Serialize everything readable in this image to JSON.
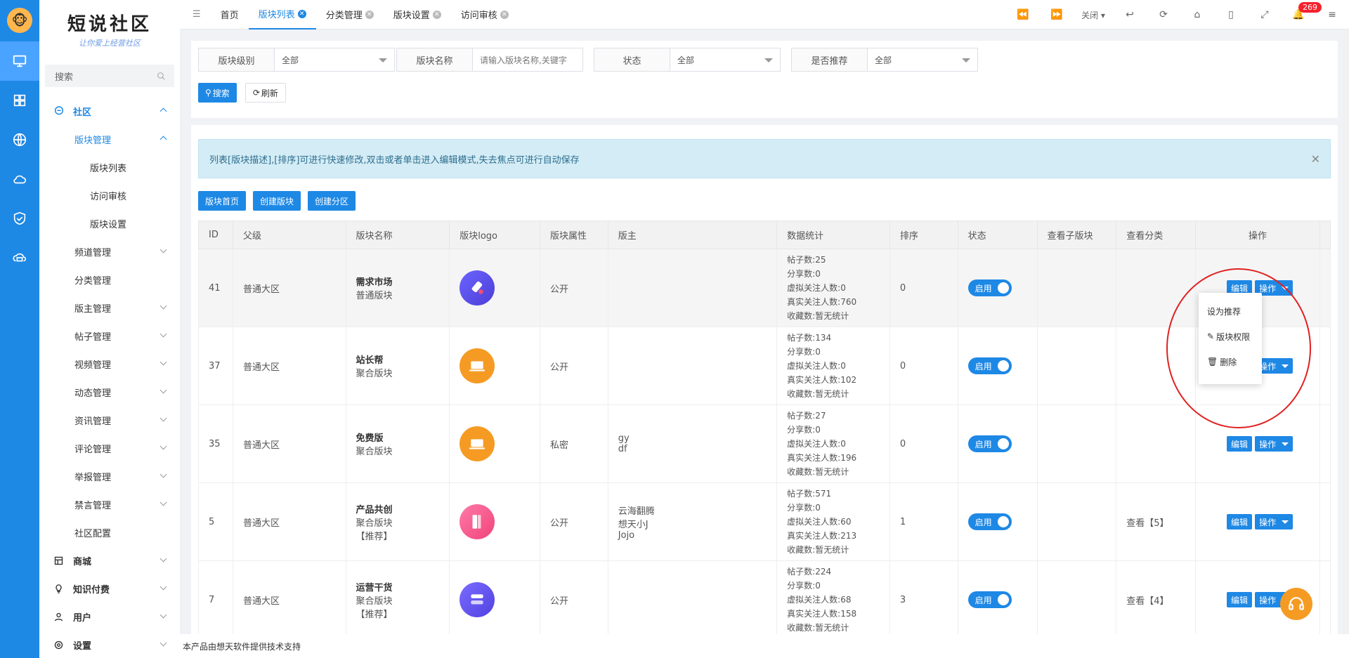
{
  "brand": {
    "title": "短说社区",
    "subtitle": "让你爱上经营社区"
  },
  "sidebar": {
    "search_placeholder": "搜索",
    "items": [
      {
        "label": "社区"
      },
      {
        "label": "版块管理"
      },
      {
        "label": "版块列表"
      },
      {
        "label": "访问审核"
      },
      {
        "label": "版块设置"
      },
      {
        "label": "频道管理"
      },
      {
        "label": "分类管理"
      },
      {
        "label": "版主管理"
      },
      {
        "label": "帖子管理"
      },
      {
        "label": "视频管理"
      },
      {
        "label": "动态管理"
      },
      {
        "label": "资讯管理"
      },
      {
        "label": "评论管理"
      },
      {
        "label": "举报管理"
      },
      {
        "label": "禁言管理"
      },
      {
        "label": "社区配置"
      },
      {
        "label": "商城"
      },
      {
        "label": "知识付费"
      },
      {
        "label": "用户"
      },
      {
        "label": "设置"
      }
    ]
  },
  "tabs": [
    {
      "label": "首页"
    },
    {
      "label": "版块列表"
    },
    {
      "label": "分类管理"
    },
    {
      "label": "版块设置"
    },
    {
      "label": "访问审核"
    }
  ],
  "toolbar": {
    "close_label": "关闭",
    "notify_count": "269"
  },
  "filters": {
    "level": {
      "label": "版块级别",
      "value": "全部"
    },
    "name": {
      "label": "版块名称",
      "placeholder": "请输入版块名称,关键字"
    },
    "status": {
      "label": "状态",
      "value": "全部"
    },
    "recommend": {
      "label": "是否推荐",
      "value": "全部"
    },
    "search_btn": "搜索",
    "refresh_btn": "刷新"
  },
  "alert": "列表[版块描述],[排序]可进行快速修改,双击或者单击进入编辑模式,失去焦点可进行自动保存",
  "actions": {
    "home": "版块首页",
    "create": "创建版块",
    "create_zone": "创建分区"
  },
  "table": {
    "headers": [
      "ID",
      "父级",
      "版块名称",
      "版块logo",
      "版块属性",
      "版主",
      "数据统计",
      "排序",
      "状态",
      "查看子版块",
      "查看分类",
      "操作"
    ],
    "rows": [
      {
        "id": "41",
        "parent": "普通大区",
        "name": "需求市场",
        "type": "普通版块",
        "tag": "",
        "attr": "公开",
        "mods": [
          "",
          "",
          ""
        ],
        "stats": [
          "帖子数:25",
          "分享数:0",
          "虚拟关注人数:0",
          "真实关注人数:760",
          "收藏数:暂无统计"
        ],
        "sort": "0",
        "status": "启用",
        "cat": ""
      },
      {
        "id": "37",
        "parent": "普通大区",
        "name": "站长帮",
        "type": "聚合版块",
        "tag": "",
        "attr": "公开",
        "mods": [
          "",
          "",
          ""
        ],
        "stats": [
          "帖子数:134",
          "分享数:0",
          "虚拟关注人数:0",
          "真实关注人数:102",
          "收藏数:暂无统计"
        ],
        "sort": "0",
        "status": "启用",
        "cat": ""
      },
      {
        "id": "35",
        "parent": "普通大区",
        "name": "免费版",
        "type": "聚合版块",
        "tag": "",
        "attr": "私密",
        "mods": [
          "gy",
          "df",
          ""
        ],
        "stats": [
          "帖子数:27",
          "分享数:0",
          "虚拟关注人数:0",
          "真实关注人数:196",
          "收藏数:暂无统计"
        ],
        "sort": "0",
        "status": "启用",
        "cat": ""
      },
      {
        "id": "5",
        "parent": "普通大区",
        "name": "产品共创",
        "type": "聚合版块",
        "tag": "【推荐】",
        "attr": "公开",
        "mods": [
          "云海翻腾",
          "想天小J",
          "Jojo"
        ],
        "stats": [
          "帖子数:571",
          "分享数:0",
          "虚拟关注人数:60",
          "真实关注人数:213",
          "收藏数:暂无统计"
        ],
        "sort": "1",
        "status": "启用",
        "cat": "查看【5】"
      },
      {
        "id": "7",
        "parent": "普通大区",
        "name": "运营干货",
        "type": "聚合版块",
        "tag": "【推荐】",
        "attr": "公开",
        "mods": [
          "",
          "",
          ""
        ],
        "stats": [
          "帖子数:224",
          "分享数:0",
          "虚拟关注人数:68",
          "真实关注人数:158",
          "收藏数:暂无统计"
        ],
        "sort": "3",
        "status": "启用",
        "cat": "查看【4】"
      }
    ],
    "edit_label": "编辑",
    "op_label": "操作"
  },
  "popup": {
    "recommend": "设为推荐",
    "perm": "版块权限",
    "delete": "删除"
  },
  "footer": "本产品由想天软件提供技术支持",
  "colors": {
    "primary": "#1e88e5",
    "annotation": "#e02020"
  }
}
